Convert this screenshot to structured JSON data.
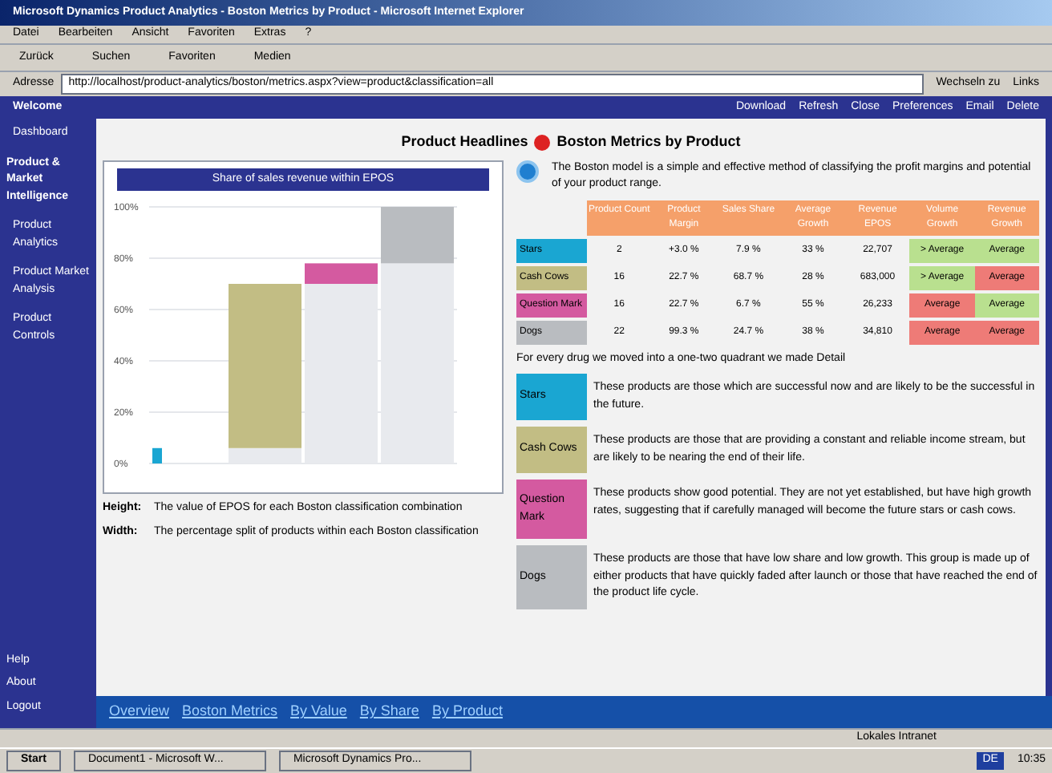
{
  "window": {
    "title": "Microsoft Dynamics Product Analytics - Boston Metrics by Product - Microsoft Internet Explorer"
  },
  "menu": [
    "Datei",
    "Bearbeiten",
    "Ansicht",
    "Favoriten",
    "Extras",
    "?"
  ],
  "toolbar": [
    "Zurück",
    "Suchen",
    "Favoriten",
    "Medien"
  ],
  "address": {
    "label": "Adresse",
    "value": "http://localhost/product-analytics/boston/metrics.aspx?view=product&classification=all",
    "go": "Wechseln zu",
    "links": "Links"
  },
  "header": {
    "title": "Welcome",
    "links": [
      "Download",
      "Refresh",
      "Close",
      "Preferences",
      "Email",
      "Delete"
    ]
  },
  "sidebar": {
    "items": [
      {
        "label": "Dashboard",
        "selected": false
      },
      {
        "label": "Product & Market Intelligence",
        "selected": true
      },
      {
        "label": "Product Analytics",
        "selected": false
      },
      {
        "label": "Product Market Analysis",
        "selected": false
      },
      {
        "label": "Product Controls",
        "selected": false
      }
    ],
    "bottom": [
      "Help",
      "About",
      "Logout"
    ]
  },
  "page_title": {
    "left": "Product Headlines",
    "right": "Boston Metrics by Product"
  },
  "chart_panel": {
    "chart_data": {
      "type": "bar",
      "title": "Share of sales revenue within EPOS",
      "stacked": true,
      "ylim": [
        0,
        100
      ],
      "yticks": [
        {
          "value": 0,
          "label": "0%"
        },
        {
          "value": 20,
          "label": "20%"
        },
        {
          "value": 40,
          "label": "40%"
        },
        {
          "value": 60,
          "label": "60%"
        },
        {
          "value": 80,
          "label": "80%"
        },
        {
          "value": 100,
          "label": "100%"
        }
      ],
      "grid": true,
      "series": [
        {
          "color": "#e8eaee",
          "values": [
            0,
            6,
            70,
            78
          ]
        },
        {
          "color": "#1aa6d2",
          "values": [
            6,
            null,
            null,
            null
          ]
        },
        {
          "color": "#c2bd84",
          "values": [
            null,
            64,
            null,
            null
          ]
        },
        {
          "color": "#d45aa0",
          "values": [
            null,
            null,
            8,
            null
          ]
        },
        {
          "color": "#b9bcc0",
          "values": [
            null,
            null,
            null,
            22
          ]
        }
      ]
    },
    "notes": [
      {
        "label": "Height:",
        "text": "The value of EPOS for each Boston classification combination"
      },
      {
        "label": "Width:",
        "text": "The percentage split of products within each Boston classification"
      }
    ]
  },
  "boston": {
    "intro": "The Boston model is a simple and effective method of classifying the profit margins and potential of your product range.",
    "columns": [
      "Product Count",
      "Product Margin",
      "Sales Share",
      "Average Growth",
      "Revenue EPOS",
      "Volume Growth",
      "Revenue Growth"
    ],
    "rows": [
      {
        "name": "Stars",
        "color": "#1aa6d2",
        "cells": [
          "2",
          "+3.0 %",
          "7.9 %",
          "33 %",
          "22,707",
          "> Average",
          "Average"
        ],
        "favorable": [
          true,
          true
        ]
      },
      {
        "name": "Cash Cows",
        "color": "#c2bd84",
        "cells": [
          "16",
          "22.7 %",
          "68.7 %",
          "28 %",
          "683,000",
          "> Average",
          "Average"
        ],
        "favorable": [
          true,
          false
        ]
      },
      {
        "name": "Question Mark",
        "color": "#d45aa0",
        "cells": [
          "16",
          "22.7 %",
          "6.7 %",
          "55 %",
          "26,233",
          "Average",
          "Average"
        ],
        "favorable": [
          false,
          true
        ]
      },
      {
        "name": "Dogs",
        "color": "#b9bcc0",
        "cells": [
          "22",
          "99.3 %",
          "24.7 %",
          "38 %",
          "34,810",
          "Average",
          "Average"
        ],
        "favorable": [
          false,
          false
        ]
      }
    ],
    "note": "For every drug we moved into a one-two quadrant we made Detail",
    "legend": [
      {
        "name": "Stars",
        "color": "#1aa6d2",
        "text": "These products are those which are successful now and are likely to be the successful in the future."
      },
      {
        "name": "Cash Cows",
        "color": "#c2bd84",
        "text": "These products are those that are providing a constant and reliable income stream, but are likely to be nearing the end of their life."
      },
      {
        "name": "Question Mark",
        "color": "#d45aa0",
        "text": "These products show good potential. They are not yet established, but have high growth rates, suggesting that if carefully managed will become the future stars or cash cows."
      },
      {
        "name": "Dogs",
        "color": "#b9bcc0",
        "text": "These products are those that have low share and low growth. This group is made up of either products that have quickly faded after launch or those that have reached the end of the product life cycle."
      }
    ]
  },
  "footer_links": [
    "Overview",
    "Boston Metrics",
    "By Value",
    "By Share",
    "By Product"
  ],
  "status_bar": {
    "zone": "Lokales Intranet"
  },
  "taskbar": {
    "start": "Start",
    "tasks": [
      "Document1 - Microsoft W...",
      "Microsoft Dynamics Pro..."
    ],
    "lang": "DE",
    "time": "10:35"
  }
}
